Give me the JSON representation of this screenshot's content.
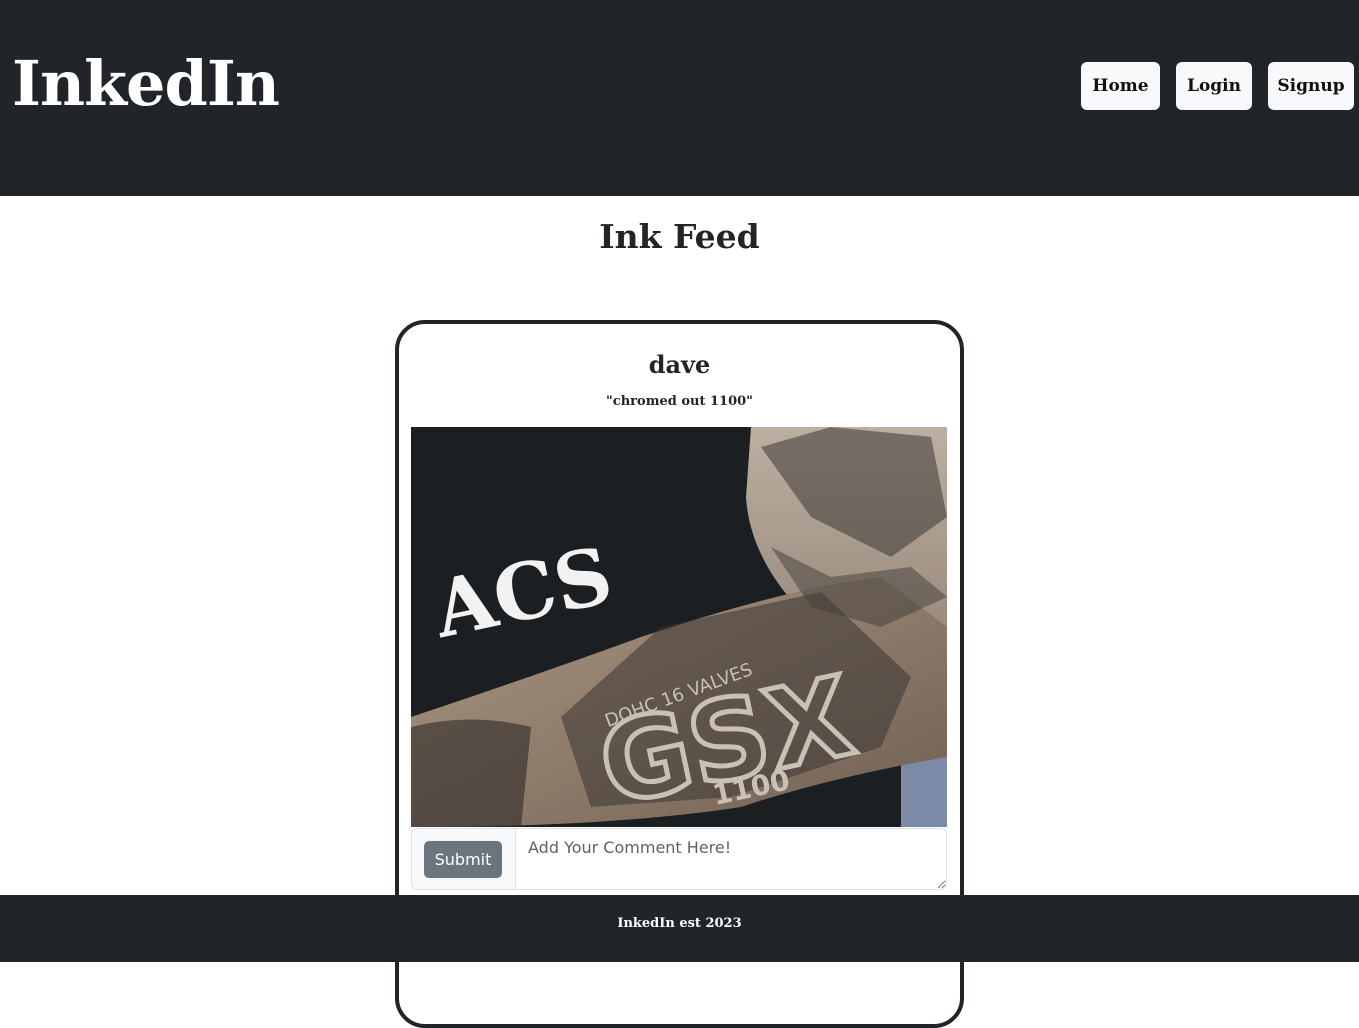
{
  "header": {
    "brand": "InkedIn",
    "nav": {
      "home": "Home",
      "login": "Login",
      "signup": "Signup"
    }
  },
  "main": {
    "title": "Ink Feed",
    "posts": [
      {
        "author": "dave",
        "caption": "\"chromed out 1100\"",
        "image": {
          "shirt_text": "ACS",
          "tattoo_text_top": "DOHC 16 VALVES",
          "tattoo_text_main": "GSX",
          "tattoo_text_bottom": "1100"
        },
        "comment": {
          "submit_label": "Submit",
          "placeholder": "Add Your Comment Here!",
          "value": ""
        }
      }
    ]
  },
  "footer": {
    "text": "InkedIn est 2023"
  },
  "colors": {
    "header_bg": "#212529",
    "nav_button_bg": "#f8f9fa",
    "submit_bg": "#6c757d",
    "card_border": "#212529"
  }
}
